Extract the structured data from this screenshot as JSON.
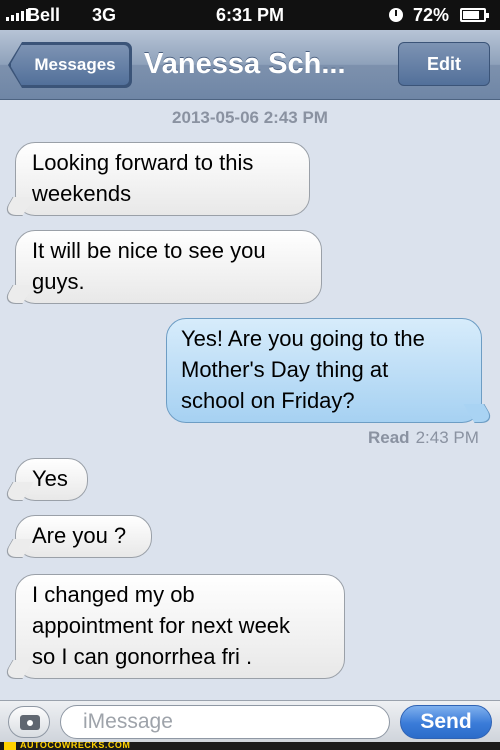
{
  "status_bar": {
    "carrier": "Bell",
    "network": "3G",
    "time": "6:31 PM",
    "battery": "72%",
    "battery_level": 0.72
  },
  "nav": {
    "back_label": "Messages",
    "title": "Vanessa Sch...",
    "edit_label": "Edit"
  },
  "conversation": {
    "timestamp": "2013-05-06 2:43 PM",
    "messages": [
      {
        "direction": "incoming",
        "lines": [
          "Looking forward to this",
          "weekends"
        ]
      },
      {
        "direction": "incoming",
        "lines": [
          "It will be nice to see you",
          "guys."
        ]
      },
      {
        "direction": "outgoing",
        "lines": [
          "Yes! Are you going to the",
          "Mother's Day thing at",
          "school on Friday?"
        ]
      },
      {
        "direction": "incoming",
        "lines": [
          "Yes"
        ]
      },
      {
        "direction": "incoming",
        "lines": [
          "Are you ?"
        ]
      },
      {
        "direction": "incoming",
        "lines": [
          "I changed my ob",
          "appointment for next week",
          "so I can gonorrhea fri ."
        ]
      }
    ],
    "read_label": "Read",
    "read_time": "2:43 PM"
  },
  "compose": {
    "placeholder": "iMessage",
    "value": "",
    "send_label": "Send"
  },
  "watermark": {
    "text": "AUTOCOWRECKS.COM"
  }
}
